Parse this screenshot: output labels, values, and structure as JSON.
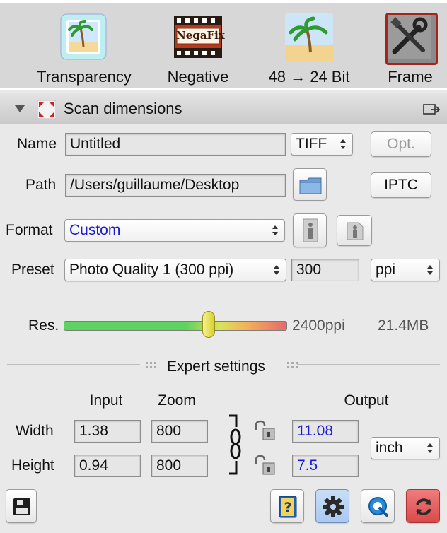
{
  "toolbar": {
    "items": [
      {
        "label": "Transparency",
        "icon": "palm-slide-icon"
      },
      {
        "label": "Negative",
        "icon": "negafix-film-icon"
      },
      {
        "label": "48 → 24 Bit",
        "icon": "palm-beach-icon"
      },
      {
        "label": "Frame",
        "icon": "tools-frame-icon"
      }
    ],
    "negafix_logo_text": "NegaFix"
  },
  "panel": {
    "title": "Scan dimensions"
  },
  "form": {
    "name_label": "Name",
    "name_value": "Untitled",
    "file_type": "TIFF",
    "opt_label": "Opt.",
    "path_label": "Path",
    "path_value": "/Users/guillaume/Desktop",
    "iptc_label": "IPTC",
    "format_label": "Format",
    "format_value": "Custom",
    "preset_label": "Preset",
    "preset_value": "Photo Quality 1 (300 ppi)",
    "preset_number": "300",
    "preset_unit": "ppi"
  },
  "resolution": {
    "label": "Res.",
    "value_text": "2400ppi",
    "size_text": "21.4MB",
    "slider_fraction": 0.65
  },
  "expert": {
    "title": "Expert settings",
    "col_input": "Input",
    "col_zoom": "Zoom",
    "col_output": "Output",
    "width_label": "Width",
    "height_label": "Height",
    "width_input": "1.38",
    "width_zoom": "800",
    "width_output": "11.08",
    "height_input": "0.94",
    "height_zoom": "800",
    "height_output": "7.5",
    "unit": "inch"
  },
  "colors": {
    "accent_blue": "#1a1ad6",
    "slider_green": "#5fd35f",
    "slider_red": "#e66a6a"
  }
}
